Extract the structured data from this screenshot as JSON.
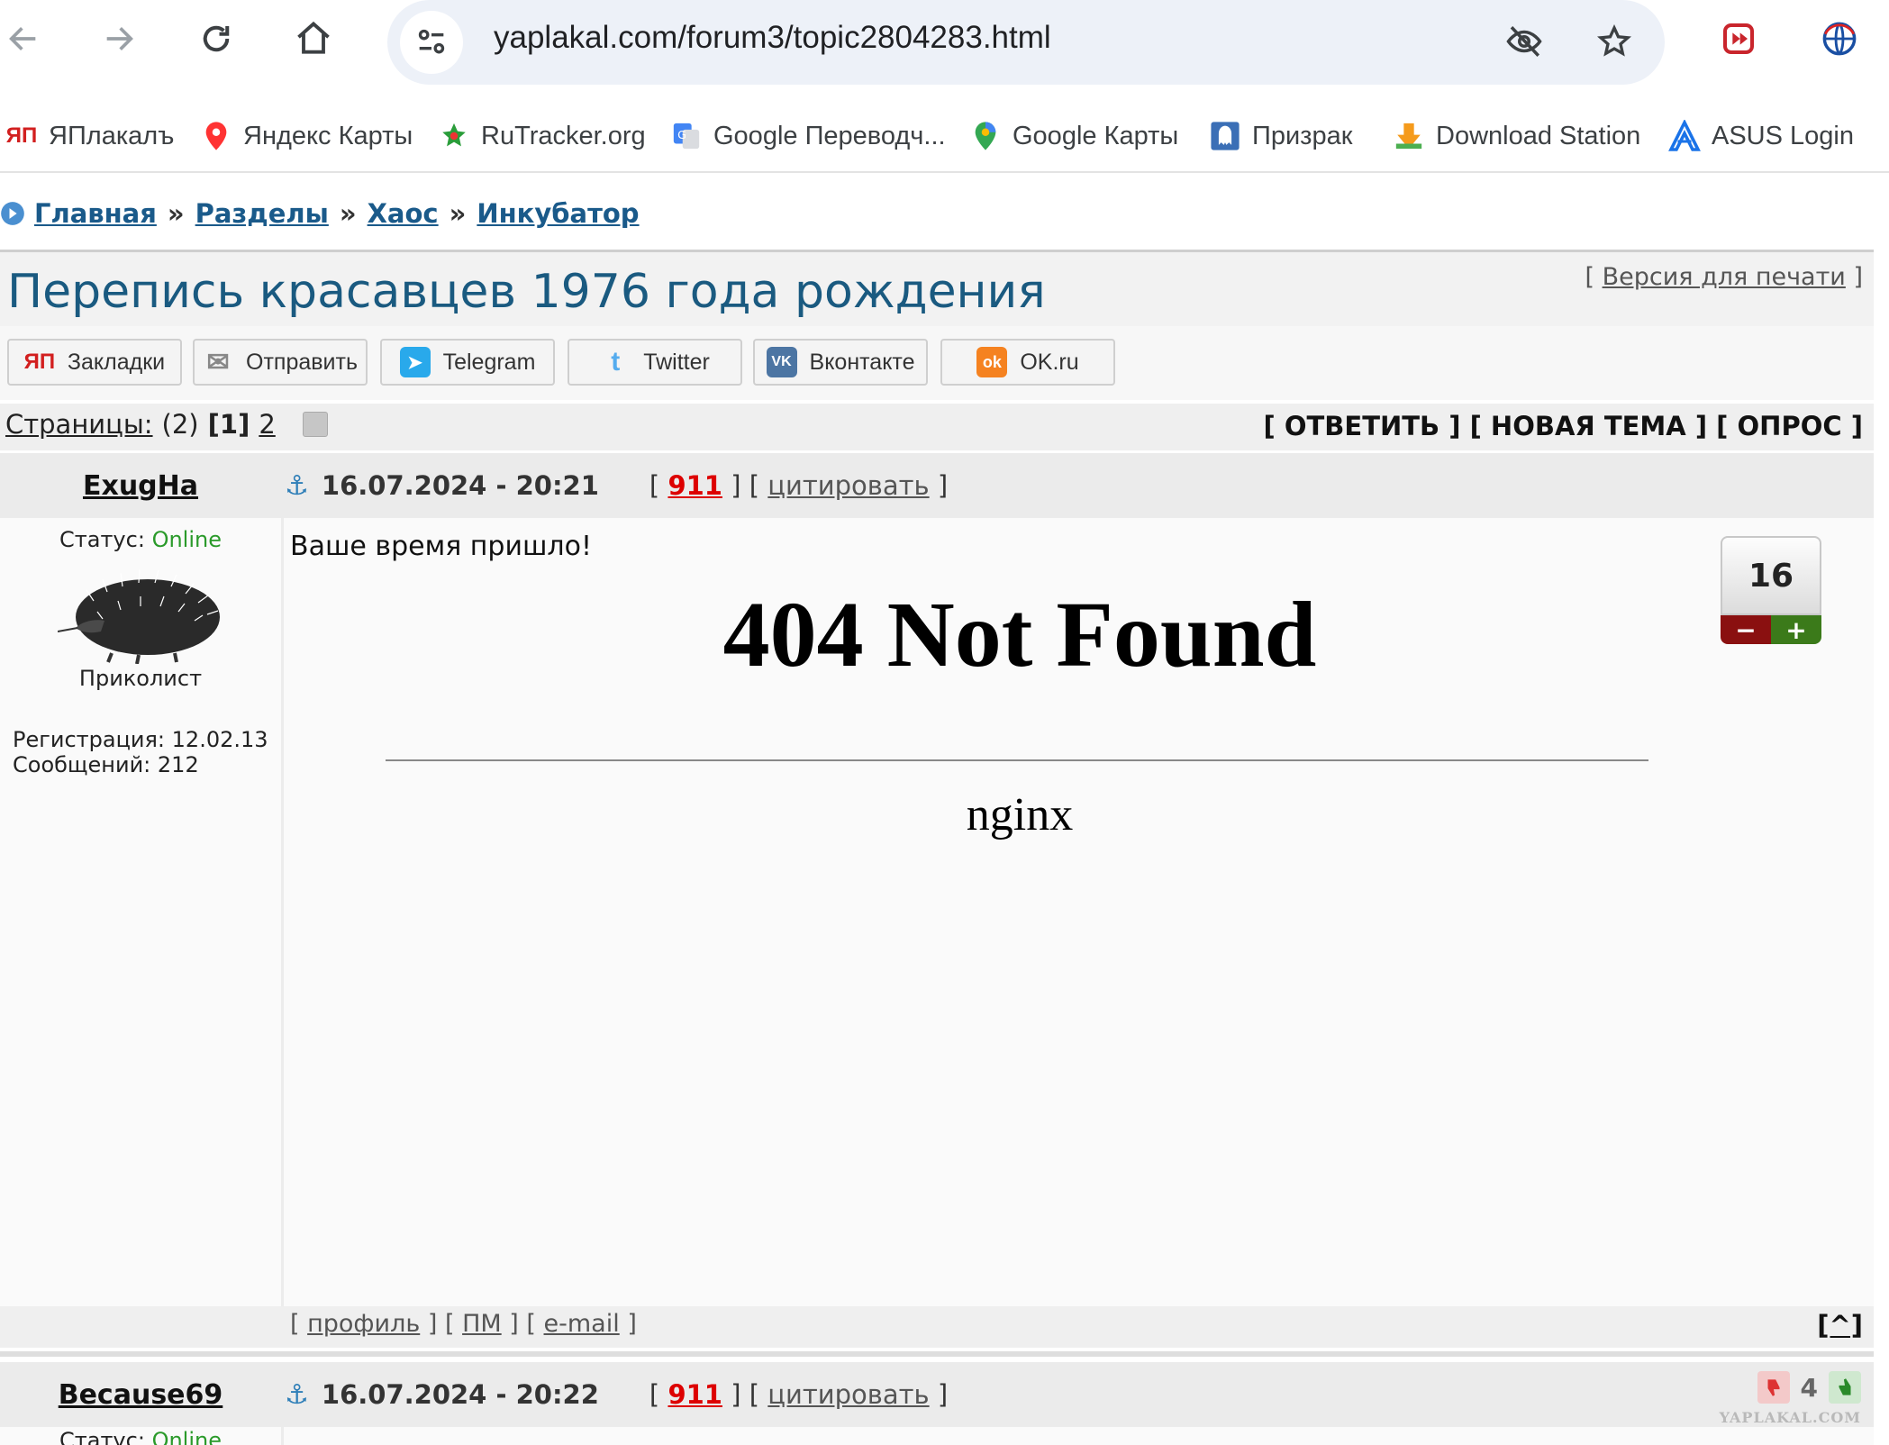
{
  "browser": {
    "url": "yaplakal.com/forum3/topic2804283.html",
    "icons": [
      "back-icon",
      "forward-icon",
      "reload-icon",
      "home-icon",
      "site-settings-icon",
      "eye-off-icon",
      "star-icon",
      "extension-icon",
      "globe-icon"
    ]
  },
  "bookmarks": [
    {
      "label": "ЯПлакалъ",
      "icon": "yaplakal-icon"
    },
    {
      "label": "Яндекс Карты",
      "icon": "map-pin-icon"
    },
    {
      "label": "RuTracker.org",
      "icon": "rutracker-icon"
    },
    {
      "label": "Google Переводч...",
      "icon": "translate-icon"
    },
    {
      "label": "Google Карты",
      "icon": "google-maps-icon"
    },
    {
      "label": "Призрак",
      "icon": "ghost-icon"
    },
    {
      "label": "Download Station",
      "icon": "download-icon"
    },
    {
      "label": "ASUS Login",
      "icon": "asus-icon"
    }
  ],
  "breadcrumb": [
    "Главная",
    "Разделы",
    "Хаос",
    "Инкубатор"
  ],
  "breadcrumb_sep": "»",
  "topic": {
    "title": "Перепись красавцев 1976 года рождения",
    "print_link": "Версия для печати",
    "bracket_open": "[",
    "bracket_close": "]"
  },
  "share": [
    {
      "label": "Закладки",
      "icon": "yap-icon",
      "color": "#d21f1f",
      "glyph": "ЯП"
    },
    {
      "label": "Отправить",
      "icon": "envelope-icon",
      "color": "#999999",
      "glyph": "✉"
    },
    {
      "label": "Telegram",
      "icon": "telegram-icon",
      "color": "#29a9eb",
      "glyph": "➤"
    },
    {
      "label": "Twitter",
      "icon": "twitter-icon",
      "color": "#55acee",
      "glyph": "t"
    },
    {
      "label": "Вконтакте",
      "icon": "vk-icon",
      "color": "#4c75a3",
      "glyph": "VK"
    },
    {
      "label": "OK.ru",
      "icon": "ok-icon",
      "color": "#f58220",
      "glyph": "ok"
    }
  ],
  "pages": {
    "label": "Страницы:",
    "count": "(2)",
    "current": "[1]",
    "next": "2"
  },
  "actions": "[ ОТВЕТИТЬ ] [ НОВАЯ ТЕМА ] [ ОПРОС ]",
  "posts": [
    {
      "author": "ExugHa",
      "date": "16.07.2024 - 20:21",
      "num": "911",
      "quote": "цитировать",
      "status_label": "Статус:",
      "status": "Online",
      "rank": "Приколист",
      "registration": "Регистрация: 12.02.13",
      "messages": "Сообщений: 212",
      "greeting": "Ваше время пришло!",
      "embed_title": "404 Not Found",
      "embed_server": "nginx",
      "rating": "16",
      "rating_minus": "−",
      "rating_plus": "+"
    },
    {
      "author": "Because69",
      "date": "16.07.2024 - 20:22",
      "num": "911",
      "quote": "цитировать",
      "status_label": "Статус:",
      "status": "Online",
      "rating": "4",
      "watermark": "YAPLAKAL.COM"
    }
  ],
  "footer_links": [
    "профиль",
    "ПМ",
    "e-mail"
  ],
  "to_top": "[^]",
  "colors": {
    "link": "#1a5a8a",
    "title": "#1a5a80",
    "online": "#2a9a2a",
    "num": "#dd0000"
  }
}
